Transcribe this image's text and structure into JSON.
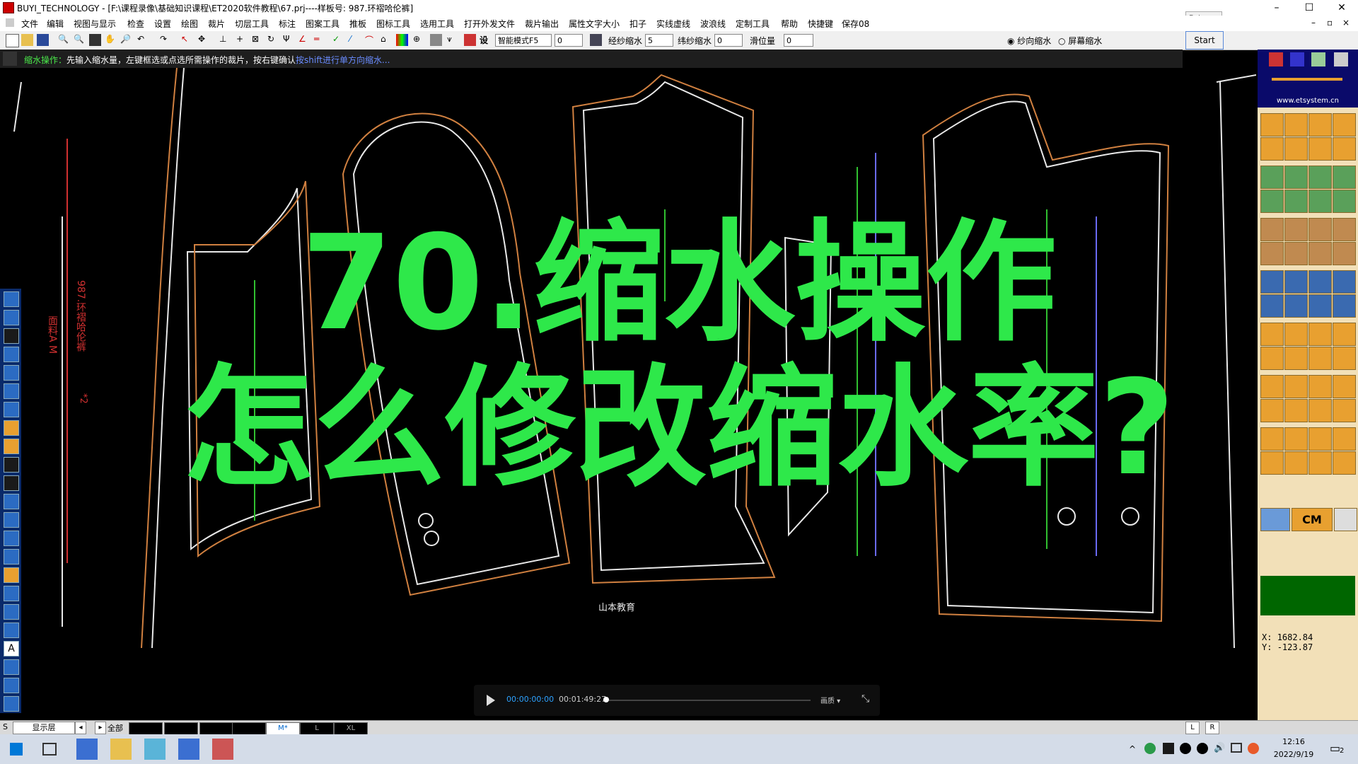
{
  "window": {
    "title": "BUYI_TECHNOLOGY - [F:\\课程录像\\基础知识课程\\ET2020软件教程\\67.prj----样板号: 987.环褶哈伦裤]",
    "minimize": "–",
    "maximize": "☐",
    "close": "✕"
  },
  "popup": {
    "text": "Poi..."
  },
  "menu": [
    "文件",
    "编辑",
    "视图与显示",
    "检查",
    "设置",
    "绘图",
    "裁片",
    "切层工具",
    "标注",
    "图案工具",
    "推板",
    "图标工具",
    "选用工具",
    "打开外发文件",
    "裁片输出",
    "属性文字大小",
    "扣子",
    "实线虚线",
    "波浪线",
    "定制工具",
    "帮助",
    "快捷键",
    "保存08"
  ],
  "toolbar": {
    "mode_select": "智能模式F5",
    "field_1": "0",
    "warp_label": "经纱缩水",
    "warp_value": "5",
    "weft_label": "纬纱缩水",
    "weft_value": "0",
    "slide_label": "滑位量",
    "slide_value": "0",
    "radio_1": "纱向缩水",
    "radio_2": "屏幕缩水",
    "start": "Start"
  },
  "status": {
    "action": "缩水操作：",
    "hint": "先输入缩水量，左键框选或点选所需操作的裁片，按右键确认",
    "hint_highlight": "按shift进行单方向缩水..."
  },
  "overlay": {
    "line1": "70.缩水操作",
    "line2": "怎么修改缩水率?"
  },
  "canvas_labels": {
    "pattern_label": "987.环褶哈伦裤",
    "fabric_label": "面料A M",
    "count_label": "*2",
    "brand_label": "山本教育"
  },
  "video": {
    "current": "00:00:00:00",
    "duration": "00:01:49:27",
    "quality": "画质 ▾",
    "progress": 0.0
  },
  "right_panel": {
    "url": "www.etsystem.cn",
    "cm_label": "CM",
    "x_label": "X:",
    "x_value": "1682.84",
    "y_label": "Y:",
    "y_value": "-123.87"
  },
  "bottom_tabs": {
    "s_label": "S",
    "layer_label": "显示层",
    "all_label": "全部",
    "sizes": [
      "M*",
      "L",
      "XL"
    ],
    "l_btn": "L",
    "r_btn": "R"
  },
  "taskbar": {
    "time": "12:16",
    "date": "2022/9/19",
    "notification_count": "2"
  },
  "colors": {
    "overlay_green": "#2ee84a",
    "pattern_white": "#e8e8e8",
    "pattern_orange": "#d08040",
    "pattern_green": "#30c030",
    "pattern_red": "#d03030"
  }
}
